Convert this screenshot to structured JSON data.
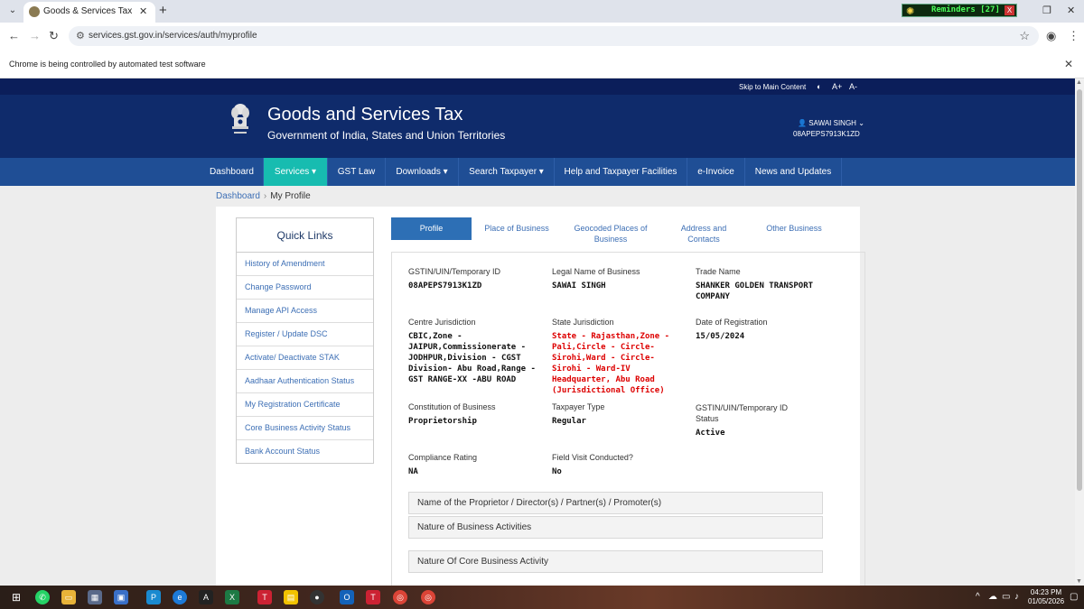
{
  "browser": {
    "tab_title": "Goods & Services Tax (GST) | U",
    "url": "services.gst.gov.in/services/auth/myprofile",
    "reminders": "Reminders [27]",
    "infobar": "Chrome is being controlled by automated test software"
  },
  "site": {
    "skip": "Skip to Main Content",
    "a11y_contrast": "◐",
    "a11y_plus": "A+",
    "a11y_minus": "A-",
    "title": "Goods and Services Tax",
    "subtitle": "Government of India, States and Union Territories",
    "user_name": "SAWAI SINGH",
    "user_gstin": "08APEPS7913K1ZD"
  },
  "nav": [
    {
      "label": "Dashboard"
    },
    {
      "label": "Services ▾"
    },
    {
      "label": "GST Law"
    },
    {
      "label": "Downloads ▾"
    },
    {
      "label": "Search Taxpayer ▾"
    },
    {
      "label": "Help and Taxpayer Facilities"
    },
    {
      "label": "e-Invoice"
    },
    {
      "label": "News and Updates"
    }
  ],
  "breadcrumb": {
    "root": "Dashboard",
    "sep": "›",
    "current": "My Profile"
  },
  "quick_links": {
    "title": "Quick Links",
    "items": [
      "History of Amendment",
      "Change Password",
      "Manage API Access",
      "Register / Update DSC",
      "Activate/ Deactivate STAK",
      "Aadhaar Authentication Status",
      "My Registration Certificate",
      "Core Business Activity Status",
      "Bank Account Status"
    ]
  },
  "profile_tabs": [
    {
      "label": "Profile"
    },
    {
      "label": "Place of Business"
    },
    {
      "label": "Geocoded Places of Business"
    },
    {
      "label": "Address and Contacts"
    },
    {
      "label": "Other Business"
    }
  ],
  "fields": {
    "gstin_label": "GSTIN/UIN/Temporary ID",
    "gstin_value": "08APEPS7913K1ZD",
    "legal_label": "Legal Name of Business",
    "legal_value": "SAWAI SINGH",
    "trade_label": "Trade Name",
    "trade_value": "SHANKER GOLDEN TRANSPORT COMPANY",
    "centre_label": "Centre Jurisdiction",
    "centre_value": "CBIC,Zone - JAIPUR,Commissionerate - JODHPUR,Division - CGST Division- Abu Road,Range - GST RANGE-XX -ABU ROAD",
    "state_label": "State Jurisdiction",
    "state_value": "State - Rajasthan,Zone - Pali,Circle - Circle-Sirohi,Ward - Circle-Sirohi - Ward-IV Headquarter, Abu Road (Jurisdictional Office)",
    "date_label": "Date of Registration",
    "date_value": "15/05/2024",
    "constitution_label": "Constitution of Business",
    "constitution_value": "Proprietorship",
    "taxpayer_label": "Taxpayer Type",
    "taxpayer_value": "Regular",
    "status_label": "GSTIN/UIN/Temporary ID Status",
    "status_value": "Active",
    "compliance_label": "Compliance Rating",
    "compliance_value": "NA",
    "visit_label": "Field Visit Conducted?",
    "visit_value": "No"
  },
  "accordions": [
    "Name of the Proprietor / Director(s) / Partner(s) / Promoter(s)",
    "Nature of Business Activities",
    "Nature Of Core Business Activity"
  ],
  "taskbar": {
    "time": "04:23 PM",
    "date": "01/05/2026"
  },
  "colors": {
    "header": "#0f2b6b",
    "nav": "#1f4e95",
    "nav_active": "#17bcb0",
    "link": "#3d6fb5",
    "red_value": "#dd0000"
  }
}
